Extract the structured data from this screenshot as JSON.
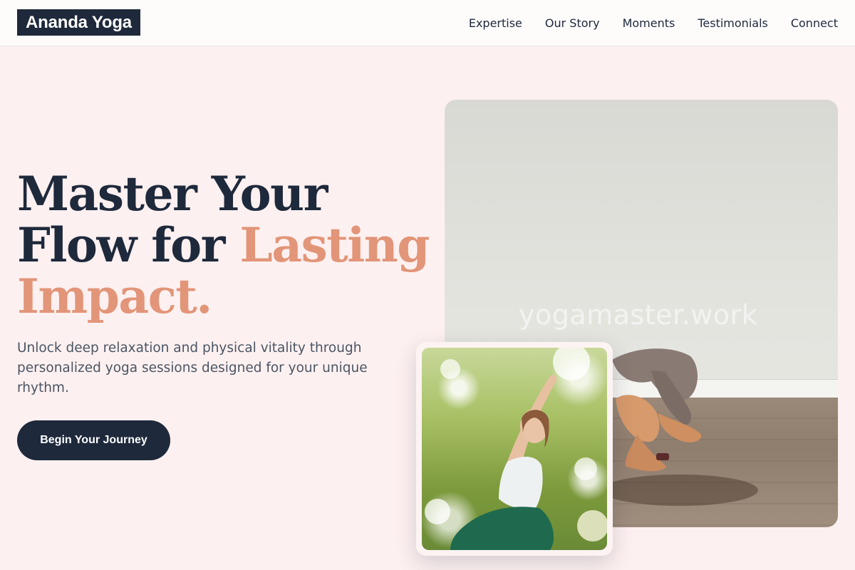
{
  "header": {
    "logo": "Ananda Yoga",
    "nav": [
      "Expertise",
      "Our Story",
      "Moments",
      "Testimonials",
      "Connect"
    ]
  },
  "hero": {
    "title_line1": "Master Your",
    "title_line2_plain": "Flow for",
    "title_line2_accent": "Lasting",
    "title_line3_accent": "Impact.",
    "subtitle": "Unlock deep relaxation and physical vitality through personalized yoga sessions designed for your unique rhythm.",
    "cta": "Begin Your Journey"
  },
  "images": {
    "watermark": "yogamaster.work"
  },
  "colors": {
    "background": "#fdf0f0",
    "primary": "#1e293b",
    "accent": "#e29578",
    "text_muted": "#4b5563"
  }
}
